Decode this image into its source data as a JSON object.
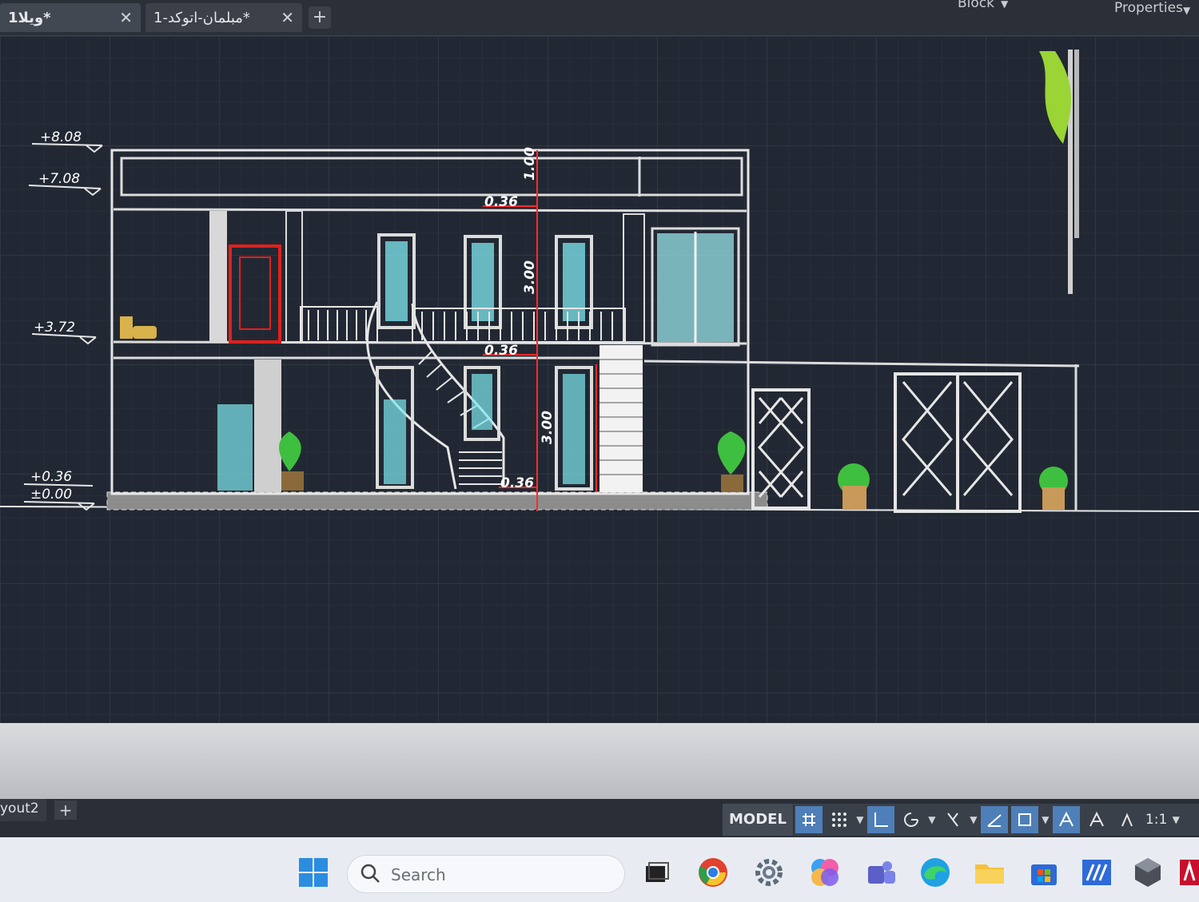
{
  "tabs": [
    {
      "label": "ویلا1*"
    },
    {
      "label": "مبلمان-اتوکد-1*"
    }
  ],
  "tab_close_glyph": "✕",
  "tab_add_glyph": "+",
  "top_right": {
    "block_label": "Block",
    "properties_label": "Properties"
  },
  "drawing": {
    "levels": [
      "+8.08",
      "+7.08",
      "+3.72",
      "+0.36",
      "±0.00"
    ],
    "dimensions": [
      "1.00",
      "0.36",
      "3.00",
      "0.36",
      "3.00",
      "0.36"
    ],
    "accent_colors": {
      "dimension_red": "#ff2a2a",
      "glass_cyan": "#7fe8f0",
      "door_red": "#e0201c",
      "plant_green": "#3fbf3f",
      "fixture_yellow": "#d8b24a"
    }
  },
  "layout_tabs": {
    "current": "yout2",
    "add": "+"
  },
  "statusbar": {
    "model_label": "MODEL",
    "scale_label": "1:1",
    "drop_glyph": "▼"
  },
  "taskbar": {
    "search_placeholder": "Search"
  }
}
